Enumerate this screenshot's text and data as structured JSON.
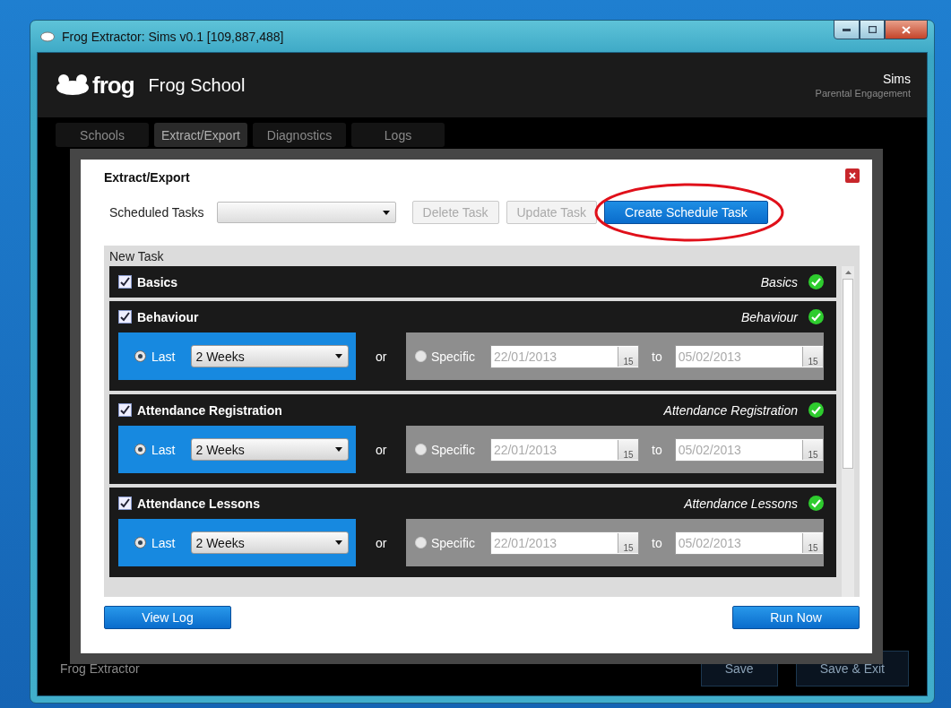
{
  "window": {
    "title": "Frog Extractor: Sims v0.1 [109,887,488]"
  },
  "header": {
    "logo": "frog",
    "school": "Frog School",
    "product": "Sims",
    "subtitle": "Parental Engagement"
  },
  "tabs": [
    {
      "label": "Schools",
      "selected": false
    },
    {
      "label": "Extract/Export",
      "selected": true
    },
    {
      "label": "Diagnostics",
      "selected": false
    },
    {
      "label": "Logs",
      "selected": false
    }
  ],
  "footer": {
    "title": "Frog Extractor",
    "buttons": [
      "Save",
      "Save & Exit"
    ]
  },
  "dialog": {
    "title": "Extract/Export",
    "scheduled_label": "Scheduled Tasks",
    "buttons": [
      {
        "label": "Delete Task",
        "disabled": true,
        "highlighted": false
      },
      {
        "label": "Update Task",
        "disabled": true,
        "highlighted": false
      },
      {
        "label": "Create Schedule Task",
        "disabled": false,
        "highlighted": true
      }
    ],
    "list_title": "New Task",
    "sections": [
      {
        "kind": "plain",
        "title": "Basics",
        "checked": true,
        "status": "Basics",
        "ok": true
      },
      {
        "kind": "range",
        "title": "Behaviour",
        "checked": true,
        "status": "Behaviour",
        "ok": true,
        "last_selected": true,
        "last_label": "Last",
        "period": "2 Weeks",
        "or": "or",
        "specific_selected": false,
        "specific_label": "Specific",
        "from": "22/01/2013",
        "from_day": "15",
        "to_label": "to",
        "to": "05/02/2013",
        "to_day": "15"
      },
      {
        "kind": "range",
        "title": "Attendance Registration",
        "checked": true,
        "status": "Attendance Registration",
        "ok": true,
        "last_selected": true,
        "last_label": "Last",
        "period": "2 Weeks",
        "or": "or",
        "specific_selected": false,
        "specific_label": "Specific",
        "from": "22/01/2013",
        "from_day": "15",
        "to_label": "to",
        "to": "05/02/2013",
        "to_day": "15"
      },
      {
        "kind": "range",
        "title": "Attendance Lessons",
        "checked": true,
        "status": "Attendance Lessons",
        "ok": true,
        "last_selected": true,
        "last_label": "Last",
        "period": "2 Weeks",
        "or": "or",
        "specific_selected": false,
        "specific_label": "Specific",
        "from": "22/01/2013",
        "from_day": "15",
        "to_label": "to",
        "to": "05/02/2013",
        "to_day": "15"
      }
    ],
    "footer_buttons": [
      "View Log",
      "Run Now"
    ]
  }
}
